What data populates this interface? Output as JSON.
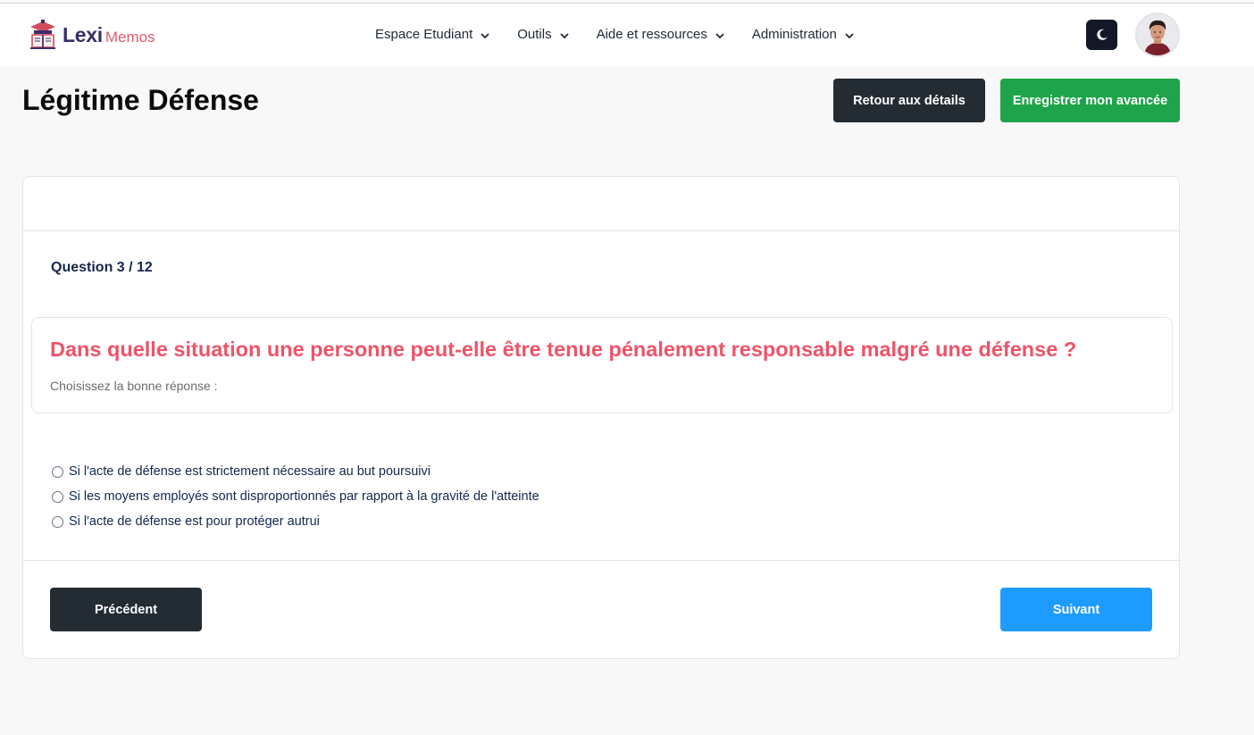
{
  "brand": {
    "name_part1": "Lexi",
    "name_part2": "Memos"
  },
  "nav": {
    "items": [
      {
        "label": "Espace Etudiant"
      },
      {
        "label": "Outils"
      },
      {
        "label": "Aide et ressources"
      },
      {
        "label": "Administration"
      }
    ]
  },
  "header": {
    "title": "Légitime Défense",
    "back_label": "Retour aux détails",
    "save_label": "Enregistrer mon avancée"
  },
  "quiz": {
    "counter": "Question 3 / 12",
    "question": "Dans quelle situation une personne peut-elle être tenue pénalement responsable malgré une défense ?",
    "instruction": "Choisissez la bonne réponse :",
    "options": [
      {
        "label": "Si l'acte de défense est strictement nécessaire au but poursuivi"
      },
      {
        "label": "Si les moyens employés sont disproportionnés par rapport à la gravité de l'atteinte"
      },
      {
        "label": "Si l'acte de défense est pour protéger autrui"
      }
    ],
    "prev_label": "Précédent",
    "next_label": "Suivant"
  },
  "colors": {
    "accent_dark": "#232b33",
    "accent_green": "#1ea44a",
    "accent_blue": "#1e9bff",
    "question_red": "#ee5368",
    "brand_purple": "#3a2d6b",
    "brand_pink": "#e05a6c"
  },
  "icons": {
    "logo": "graduation-cap-book-icon",
    "chevron": "chevron-down-icon",
    "theme": "moon-icon",
    "avatar": "user-avatar"
  }
}
